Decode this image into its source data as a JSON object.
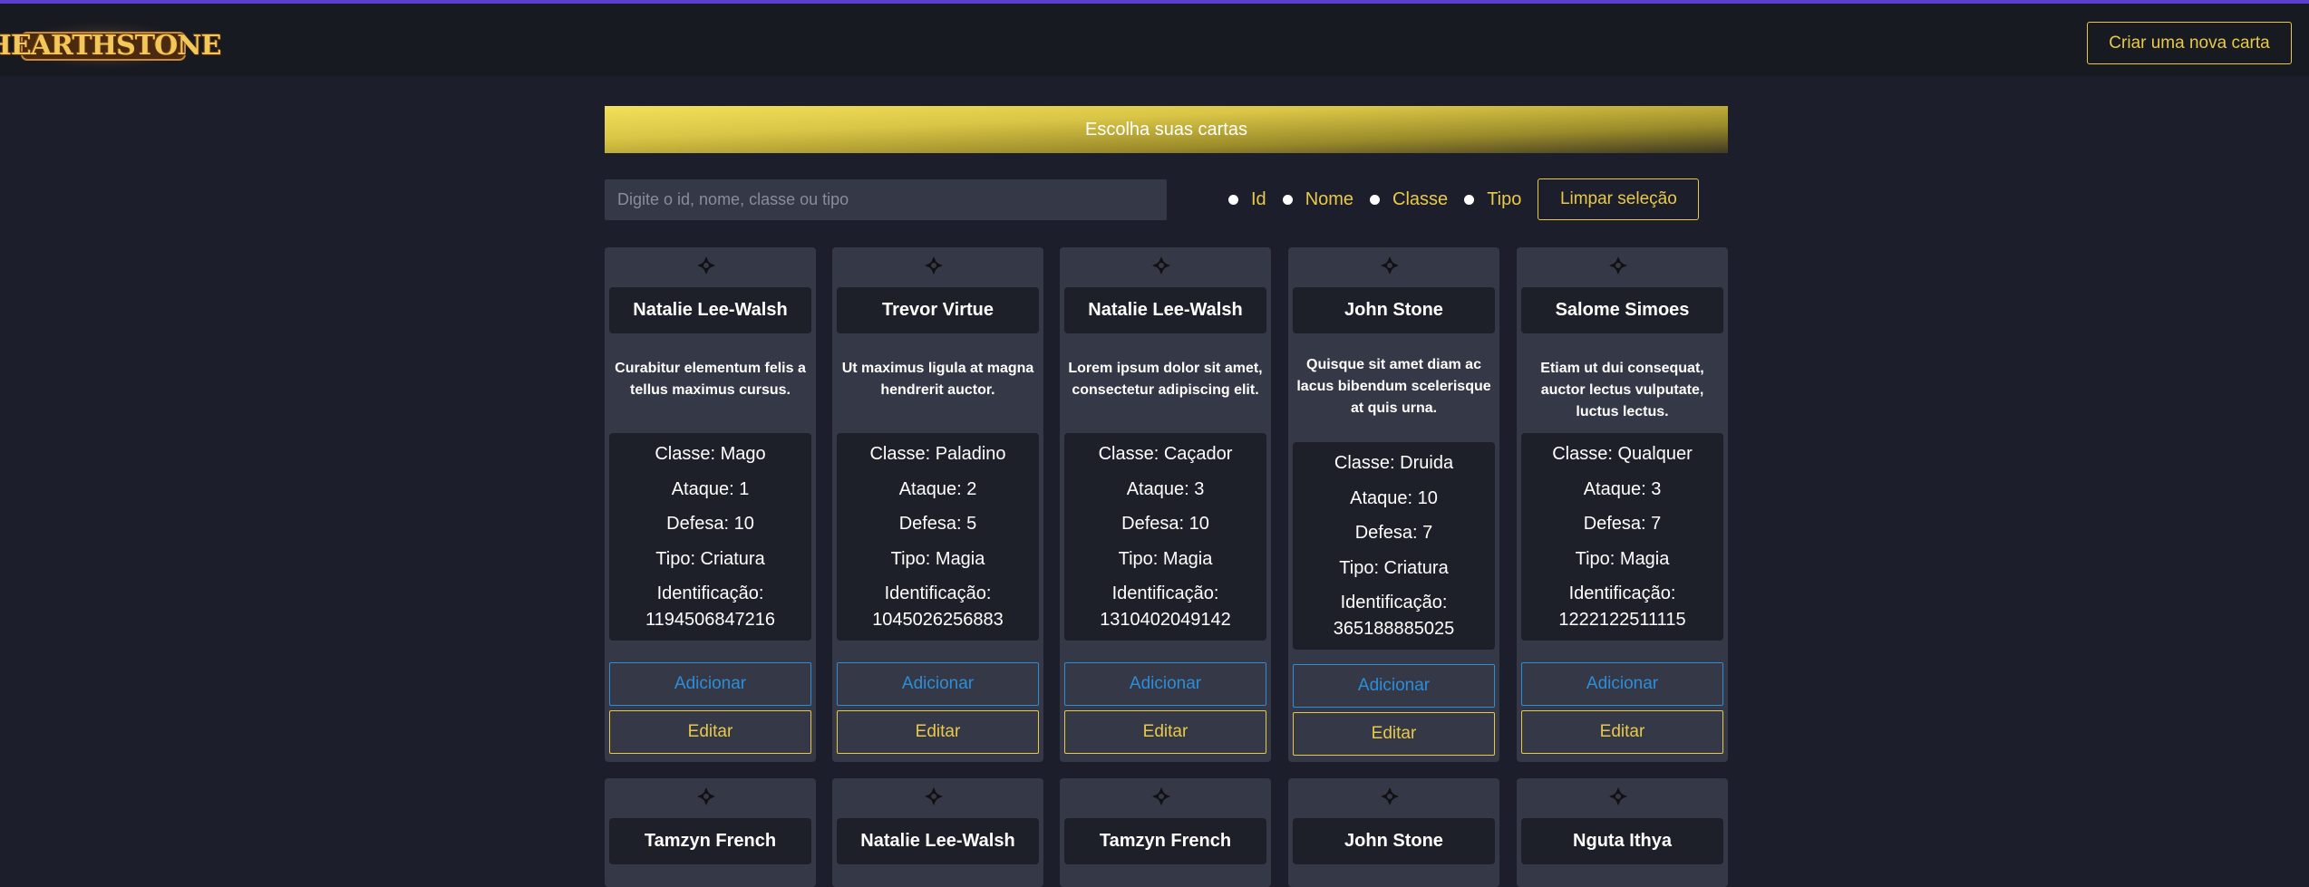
{
  "header": {
    "logo_text": "HEARTHSTONE",
    "new_card_label": "Criar uma nova carta"
  },
  "banner": {
    "title": "Escolha suas cartas"
  },
  "search": {
    "placeholder": "Digite o id, nome, classe ou tipo",
    "value": ""
  },
  "filters": {
    "options": [
      "Id",
      "Nome",
      "Classe",
      "Tipo"
    ],
    "clear_label": "Limpar seleção"
  },
  "cards": [
    {
      "name": "Natalie Lee-Walsh",
      "description": "Curabitur elementum felis a tellus maximus cursus.",
      "classe": "Classe: Mago",
      "ataque": "Ataque: 1",
      "defesa": "Defesa: 10",
      "tipo": "Tipo: Criatura",
      "id_label": "Identificação:",
      "id": "1194506847216",
      "add": "Adicionar",
      "edit": "Editar"
    },
    {
      "name": "Trevor Virtue",
      "description": "Ut maximus ligula at magna hendrerit auctor.",
      "classe": "Classe: Paladino",
      "ataque": "Ataque: 2",
      "defesa": "Defesa: 5",
      "tipo": "Tipo: Magia",
      "id_label": "Identificação:",
      "id": "1045026256883",
      "add": "Adicionar",
      "edit": "Editar"
    },
    {
      "name": "Natalie Lee-Walsh",
      "description": "Lorem ipsum dolor sit amet, consectetur adipiscing elit.",
      "classe": "Classe: Caçador",
      "ataque": "Ataque: 3",
      "defesa": "Defesa: 10",
      "tipo": "Tipo: Magia",
      "id_label": "Identificação:",
      "id": "1310402049142",
      "add": "Adicionar",
      "edit": "Editar"
    },
    {
      "name": "John Stone",
      "description": "Quisque sit amet diam ac lacus bibendum scelerisque at quis urna.",
      "classe": "Classe: Druida",
      "ataque": "Ataque: 10",
      "defesa": "Defesa: 7",
      "tipo": "Tipo: Criatura",
      "id_label": "Identificação:",
      "id": "365188885025",
      "add": "Adicionar",
      "edit": "Editar"
    },
    {
      "name": "Salome Simoes",
      "description": "Etiam ut dui consequat, auctor lectus vulputate, luctus lectus.",
      "classe": "Classe: Qualquer",
      "ataque": "Ataque: 3",
      "defesa": "Defesa: 7",
      "tipo": "Tipo: Magia",
      "id_label": "Identificação:",
      "id": "1222122511115",
      "add": "Adicionar",
      "edit": "Editar"
    },
    {
      "name": "Tamzyn French"
    },
    {
      "name": "Natalie Lee-Walsh"
    },
    {
      "name": "Tamzyn French"
    },
    {
      "name": "John Stone"
    },
    {
      "name": "Nguta Ithya"
    }
  ],
  "colors": {
    "accent": "#e8c94a",
    "add_blue": "#2d8ed8",
    "top_border": "#5b3fd0"
  }
}
